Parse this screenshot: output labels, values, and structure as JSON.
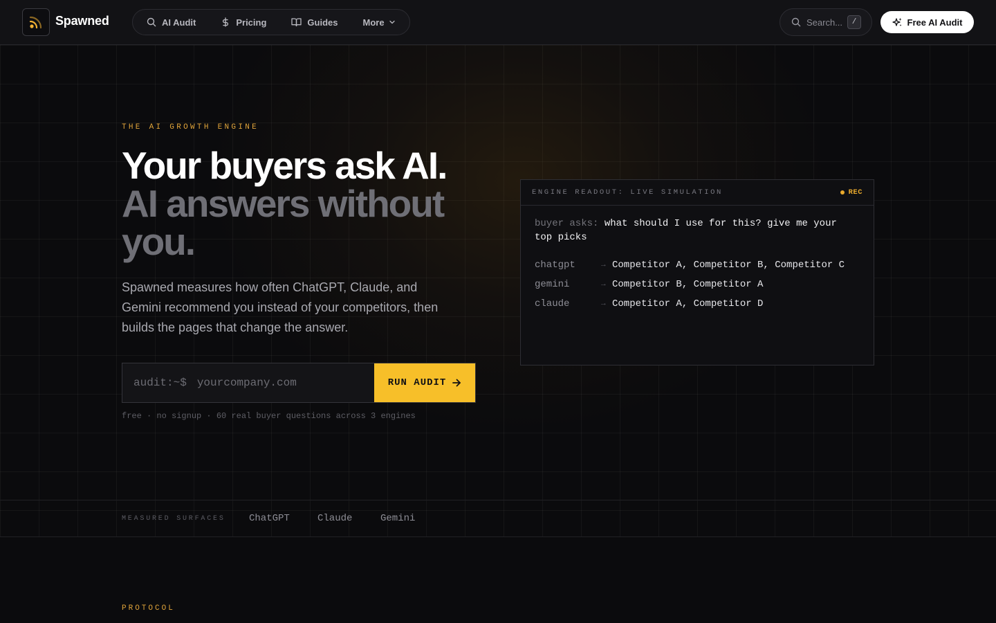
{
  "header": {
    "brand": "Spawned",
    "nav": [
      {
        "label": "AI Audit",
        "icon": "search-icon"
      },
      {
        "label": "Pricing",
        "icon": "dollar-icon"
      },
      {
        "label": "Guides",
        "icon": "book-icon"
      },
      {
        "label": "More",
        "icon": "chevron-down-icon"
      }
    ],
    "search_placeholder": "Search...",
    "search_shortcut": "/",
    "cta_label": "Free AI Audit"
  },
  "hero": {
    "eyebrow": "THE AI GROWTH ENGINE",
    "headline_line1": "Your buyers ask AI.",
    "headline_line2": "AI answers without you.",
    "lead": "Spawned measures how often ChatGPT, Claude, and Gemini recommend you instead of your competitors, then builds the pages that change the answer.",
    "prompt": "audit:~$",
    "input_placeholder": "yourcompany.com",
    "button_label": "RUN AUDIT",
    "fineprint": "free · no signup · 60 real buyer questions across 3 engines"
  },
  "readout": {
    "title": "ENGINE READOUT: LIVE SIMULATION",
    "rec_label": "REC",
    "question_prefix": "buyer asks:",
    "question": "what should I use for this? give me your top picks",
    "arrow": "→",
    "rows": [
      {
        "engine": "chatgpt",
        "answer": "Competitor A, Competitor B, Competitor C"
      },
      {
        "engine": "gemini",
        "answer": "Competitor B, Competitor A"
      },
      {
        "engine": "claude",
        "answer": "Competitor A, Competitor D"
      }
    ]
  },
  "surfaces": {
    "label": "MEASURED SURFACES",
    "items": [
      "ChatGPT",
      "Claude",
      "Gemini"
    ]
  },
  "next_section": {
    "eyebrow": "PROTOCOL"
  },
  "colors": {
    "accent": "#f7bf29",
    "eyebrow": "#e0a43a",
    "background": "#0b0b0d"
  }
}
